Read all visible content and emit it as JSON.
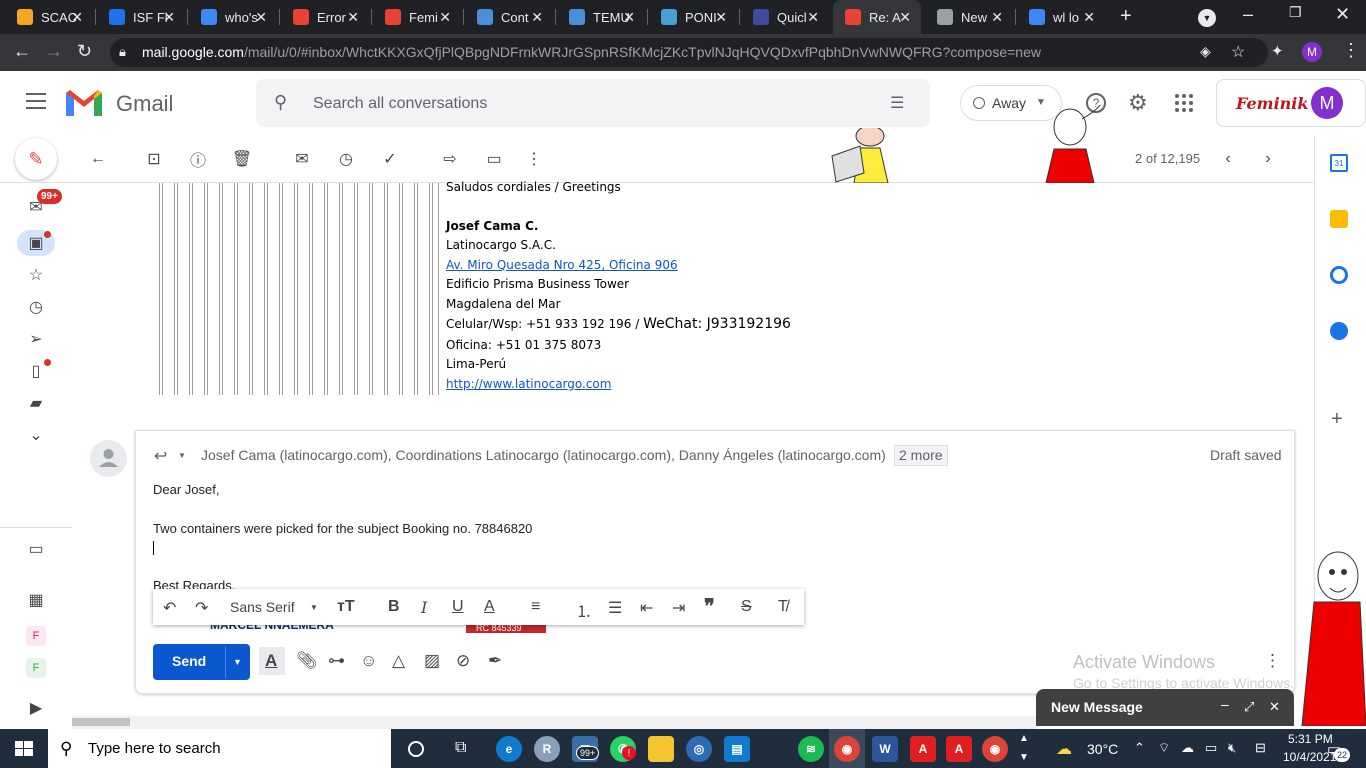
{
  "browser": {
    "tabs": [
      {
        "label": "SCAC",
        "icon": "scac-icon",
        "color": "#f5a623"
      },
      {
        "label": "ISF Fi",
        "icon": "isf-icon",
        "color": "#1a73e8"
      },
      {
        "label": "who's",
        "icon": "google-icon",
        "color": "#4285f4"
      },
      {
        "label": "Error",
        "icon": "error-page-icon",
        "color": "#ea4335"
      },
      {
        "label": "Femi",
        "icon": "gmail-icon",
        "color": "#ea4335"
      },
      {
        "label": "Cont",
        "icon": "box-icon",
        "color": "#4a90d9"
      },
      {
        "label": "TEMU",
        "icon": "box-icon",
        "color": "#4a90d9"
      },
      {
        "label": "PONI",
        "icon": "snowflake-icon",
        "color": "#4a9fd5"
      },
      {
        "label": "Quicl",
        "icon": "quick-icon",
        "color": "#3c4aa0"
      },
      {
        "label": "Re: A",
        "icon": "gmail-icon",
        "color": "#ea4335"
      },
      {
        "label": "New",
        "icon": "chrome-icon",
        "color": "#9aa0a6"
      },
      {
        "label": "wl lo",
        "icon": "google-icon",
        "color": "#4285f4"
      }
    ],
    "url_host": "mail.google.com",
    "url_path": "/mail/u/0/#inbox/WhctKKXGxQfjPlQBpgNDFrnkWRJrGSpnRSfKMcjZKcTpvlNJqHQVQDxvfPqbhDnVwNWQFRG?compose=new",
    "profile_initial": "M"
  },
  "gmail": {
    "logo_text": "Gmail",
    "search_placeholder": "Search all conversations",
    "status_label": "Away",
    "brand_badge": "Feminik",
    "avatar_initial": "M",
    "inbox_badge": "99+",
    "pager": "2 of 12,195"
  },
  "signature": {
    "greeting": "Saludos cordiales / Greetings",
    "name": "Josef Cama C.",
    "company": "Latinocargo S.A.C.",
    "address": "Av. Miro Quesada Nro 425, Oficina 906",
    "building": "Edificio Prisma Business Tower",
    "district": "Magdalena del Mar",
    "mobile": "Celular/Wsp: +51 933 192 196 / ",
    "wechat": "WeChat: J933192196",
    "office": "Oficina: +51 01 375 8073",
    "city": "Lima-Perú",
    "website": "http://www.latinocargo.com"
  },
  "reply": {
    "recipients": "Josef Cama (latinocargo.com), Coordinations Latinocargo (latinocargo.com), Danny Ángeles (latinocargo.com)",
    "more": "2 more",
    "draft_status": "Draft saved",
    "body": {
      "line1": "Dear Josef,",
      "line2": "Two containers were picked for the subject Booking no. 78846820",
      "line3": "Best Regards,",
      "sig_name": "MARCEL NNAEMERA",
      "sig_badge": "RC 845339"
    },
    "font_label": "Sans Serif",
    "send_label": "Send"
  },
  "watermark": {
    "line1": "Activate Windows",
    "line2": "Go to Settings to activate Windows."
  },
  "new_message": {
    "title": "New Message"
  },
  "taskbar": {
    "search_placeholder": "Type here to search",
    "badge": "99+",
    "temperature": "30°C",
    "time": "5:31 PM",
    "date": "10/4/2021",
    "notifications": "22"
  },
  "colors": {
    "chrome_dark": "#202124",
    "send_blue": "#0b57d0",
    "taskbar": "#1f2d3d"
  }
}
